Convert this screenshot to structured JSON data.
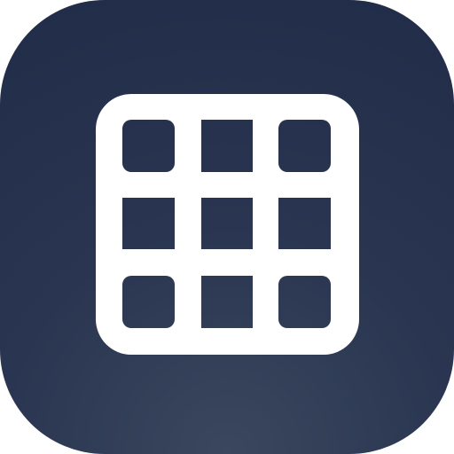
{
  "icon": {
    "semantic": "grid-icon",
    "rows": 3,
    "columns": 3
  },
  "colors": {
    "background_top": "#212c48",
    "background_bottom": "#3a475e",
    "glyph": "#ffffff"
  }
}
